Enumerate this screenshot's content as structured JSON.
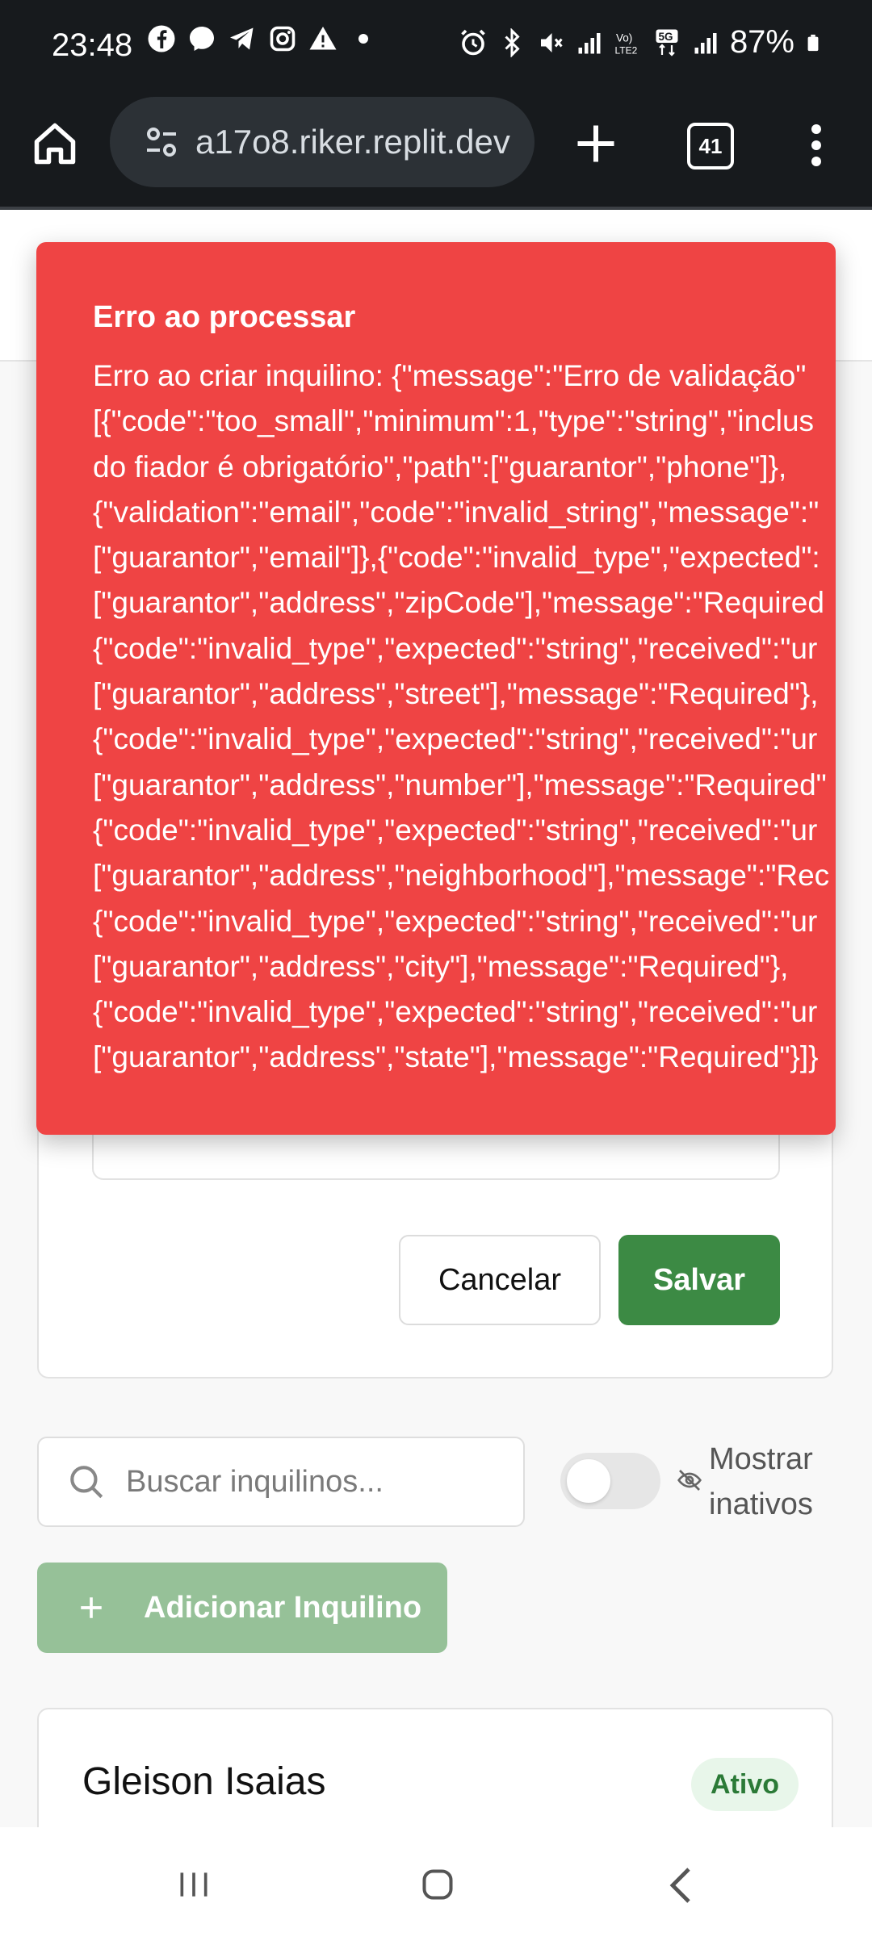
{
  "status_bar": {
    "time": "23:48",
    "battery": "87%",
    "icons_left": [
      "facebook-icon",
      "messenger-icon",
      "telegram-icon",
      "instagram-icon",
      "warning-icon",
      "dot-icon"
    ],
    "icons_right": [
      "alarm-icon",
      "bluetooth-icon",
      "mute-icon",
      "signal-icon",
      "volte-icon",
      "5g-icon",
      "signal-icon",
      "battery-icon"
    ]
  },
  "browser": {
    "url": "a17o8.riker.replit.dev",
    "tab_count": "41"
  },
  "toast": {
    "title": "Erro ao processar",
    "lines": [
      "Erro ao criar inquilino: {\"message\":\"Erro de validação\"",
      "[{\"code\":\"too_small\",\"minimum\":1,\"type\":\"string\",\"inclus",
      "do fiador é obrigatório\",\"path\":[\"guarantor\",\"phone\"]},",
      "{\"validation\":\"email\",\"code\":\"invalid_string\",\"message\":\"",
      "[\"guarantor\",\"email\"]},{\"code\":\"invalid_type\",\"expected\":",
      "[\"guarantor\",\"address\",\"zipCode\"],\"message\":\"Required",
      "{\"code\":\"invalid_type\",\"expected\":\"string\",\"received\":\"ur",
      "[\"guarantor\",\"address\",\"street\"],\"message\":\"Required\"},",
      "{\"code\":\"invalid_type\",\"expected\":\"string\",\"received\":\"ur",
      "[\"guarantor\",\"address\",\"number\"],\"message\":\"Required\"",
      "{\"code\":\"invalid_type\",\"expected\":\"string\",\"received\":\"ur",
      "[\"guarantor\",\"address\",\"neighborhood\"],\"message\":\"Rec",
      "{\"code\":\"invalid_type\",\"expected\":\"string\",\"received\":\"ur",
      "[\"guarantor\",\"address\",\"city\"],\"message\":\"Required\"},",
      "{\"code\":\"invalid_type\",\"expected\":\"string\",\"received\":\"ur",
      "[\"guarantor\",\"address\",\"state\"],\"message\":\"Required\"}]}"
    ],
    "color": "#ef4444"
  },
  "form": {
    "cancel_label": "Cancelar",
    "save_label": "Salvar",
    "save_color": "#3c8a44"
  },
  "toolbar": {
    "search_placeholder": "Buscar inquilinos...",
    "show_inactive_line1": "Mostrar",
    "show_inactive_line2": "inativos",
    "show_inactive_on": false,
    "add_label": "Adicionar Inquilino"
  },
  "tenants": [
    {
      "name": "Gleison Isaias",
      "status": "Ativo"
    }
  ]
}
